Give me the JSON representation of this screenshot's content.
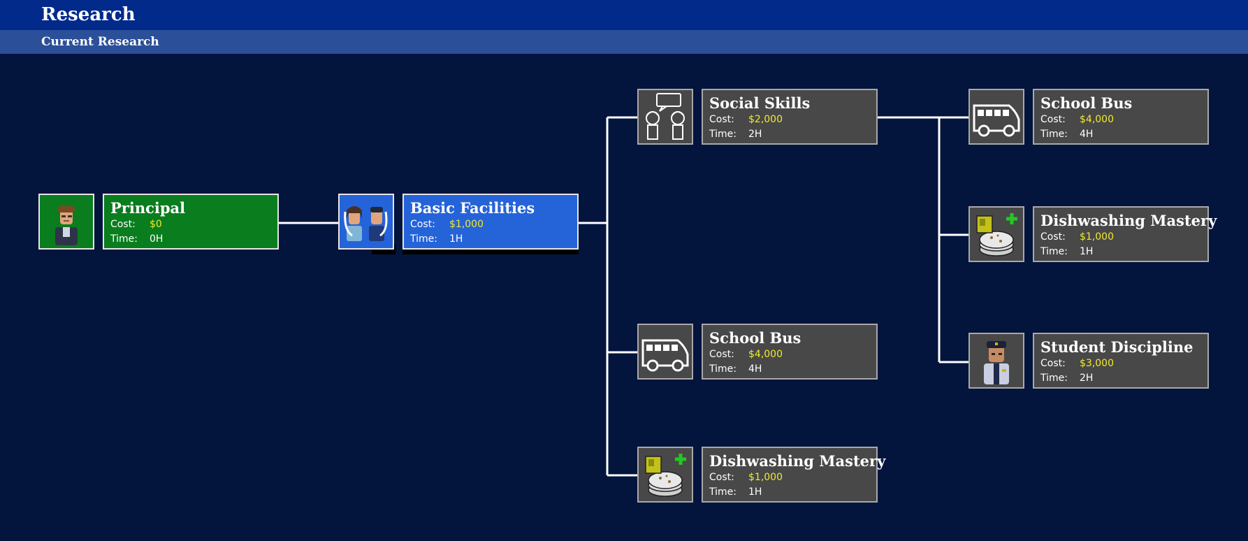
{
  "header": {
    "title": "Research",
    "subtitle": "Current Research"
  },
  "labels": {
    "cost": "Cost:",
    "time": "Time:"
  },
  "colors": {
    "completed": "#0a7d1f",
    "in_progress": "#2563d8",
    "locked": "#484848",
    "cost_text": "#f2ea2b",
    "background": "#03143d"
  },
  "nodes": [
    {
      "title": "Principal",
      "cost": "$0",
      "time": "0H",
      "icon": "principal-icon",
      "status": "completed"
    },
    {
      "title": "Basic Facilities",
      "cost": "$1,000",
      "time": "1H",
      "icon": "students-icon",
      "status": "in-progress"
    },
    {
      "title": "Social Skills",
      "cost": "$2,000",
      "time": "2H",
      "icon": "social-skills-icon",
      "status": "locked"
    },
    {
      "title": "School Bus",
      "cost": "$4,000",
      "time": "4H",
      "icon": "bus-icon",
      "status": "locked"
    },
    {
      "title": "Dishwashing Mastery",
      "cost": "$1,000",
      "time": "1H",
      "icon": "dishes-icon",
      "status": "locked"
    },
    {
      "title": "School Bus",
      "cost": "$4,000",
      "time": "4H",
      "icon": "bus-icon",
      "status": "locked"
    },
    {
      "title": "Dishwashing Mastery",
      "cost": "$1,000",
      "time": "1H",
      "icon": "dishes-icon",
      "status": "locked"
    },
    {
      "title": "Student Discipline",
      "cost": "$3,000",
      "time": "2H",
      "icon": "security-guard-icon",
      "status": "locked"
    }
  ]
}
